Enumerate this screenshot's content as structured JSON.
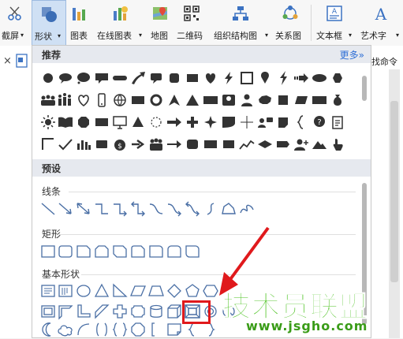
{
  "toolbar": {
    "screenshot_label": "截屏",
    "shapes_label": "形状",
    "chart_label": "图表",
    "online_chart_label": "在线图表",
    "map_label": "地图",
    "qrcode_label": "二维码",
    "org_chart_label": "组织结构图",
    "relation_label": "关系图",
    "textbox_label": "文本框",
    "wordart_label": "艺术字"
  },
  "side": {
    "find_command": "找命令",
    "close_tab": "×"
  },
  "panel": {
    "recommended_title": "推荐",
    "more_label": "更多»",
    "preset_title": "预设",
    "lines_label": "线条",
    "rect_label": "矩形",
    "basic_label": "基本形状"
  },
  "watermark": {
    "title": "技术员联盟",
    "url": "www.jsgho.com"
  },
  "colors": {
    "accent": "#2f6fd6",
    "shape_stroke": "#4a6fa5",
    "highlight_red": "#e0191c",
    "watermark_green": "#49c11d"
  }
}
